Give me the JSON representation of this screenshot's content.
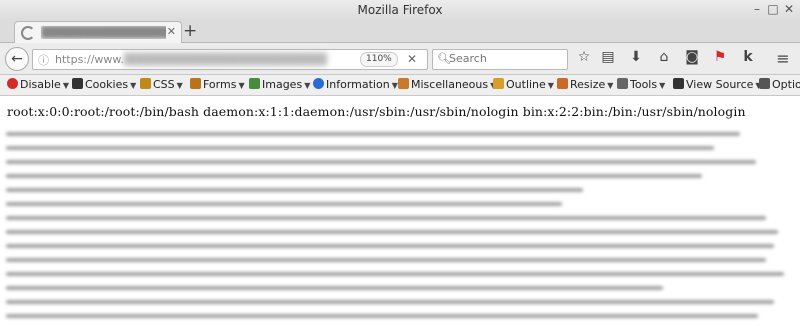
{
  "window": {
    "title": "Mozilla Firefox",
    "controls": {
      "minimize": "–",
      "maximize": "□",
      "close": "✕"
    }
  },
  "tab": {
    "title": "████████████████",
    "close_icon": "✕",
    "new_tab_label": "+"
  },
  "navbar": {
    "back_icon": "←",
    "info_icon": "ⓘ",
    "url_prefix": "https://www.",
    "url_rest": "████████████████████████",
    "zoom": "110%",
    "clear_icon": "✕",
    "search_placeholder": "Search",
    "icons": [
      "bookmark-star-icon",
      "reading-list-icon",
      "download-icon",
      "home-icon",
      "pocket-icon",
      "flag-icon",
      "k-icon",
      "hamburger-menu-icon"
    ]
  },
  "devbar": {
    "items": [
      {
        "label": "Disable",
        "icon": "disable-icon",
        "color": "#d42a2a"
      },
      {
        "label": "Cookies",
        "icon": "cookies-icon",
        "color": "#333333"
      },
      {
        "label": "CSS",
        "icon": "css-icon",
        "color": "#c08a1a"
      },
      {
        "label": "Forms",
        "icon": "forms-icon",
        "color": "#b8741a"
      },
      {
        "label": "Images",
        "icon": "images-icon",
        "color": "#4a8a3a"
      },
      {
        "label": "Information",
        "icon": "information-icon",
        "color": "#2a6ad4"
      },
      {
        "label": "Miscellaneous",
        "icon": "miscellaneous-icon",
        "color": "#c87a2a"
      },
      {
        "label": "Outline",
        "icon": "outline-icon",
        "color": "#d4a02a"
      },
      {
        "label": "Resize",
        "icon": "resize-icon",
        "color": "#c86a2a"
      },
      {
        "label": "Tools",
        "icon": "tools-icon",
        "color": "#666666"
      },
      {
        "label": "View Source",
        "icon": "view-source-icon",
        "color": "#333333"
      },
      {
        "label": "Options",
        "icon": "options-icon",
        "color": "#555555"
      }
    ]
  },
  "content": {
    "first_line": "root:x:0:0:root:/root:/bin/bash daemon:x:1:1:daemon:/usr/sbin:/usr/sbin/nologin bin:x:2:2:bin:/bin:/usr/sbin/nologin"
  }
}
